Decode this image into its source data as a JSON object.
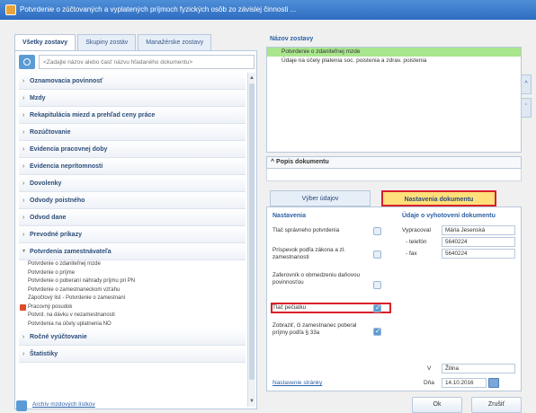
{
  "window": {
    "title": "Potvrdenie o zúčtovaných a vyplatených príjmoch fyzických osôb zo závislej činnosti ..."
  },
  "left": {
    "tabs": [
      "Všetky zostavy",
      "Skupiny zostáv",
      "Manažérske zostavy"
    ],
    "search_placeholder": "<Zadajte názov alebo časť názvu hľadaného dokumentu>",
    "categories_before": [
      "Oznamovacia povinnosť",
      "Mzdy",
      "Rekapitulácia miezd a prehľad ceny práce",
      "Rozúčtovanie",
      "Evidencia pracovnej doby",
      "Evidencia neprítomnosti",
      "Dovolenky",
      "Odvody poistného",
      "Odvod dane",
      "Prevodné príkazy"
    ],
    "open_category": "Potvrdenia zamestnávateľa",
    "subitems": [
      "Potvrdenie o zdaniteľnej mzde",
      "Potvrdenie o príjme",
      "Potvrdenie o poberaní náhrady príjmu pri PN",
      "Potvrdenie o zamestnaneckom vzťahu",
      "Zápočtový list - Potvrdenie o zamestnaní",
      "Pracovný posudok",
      "Potvrd. na dávku v nezamestnanosti",
      "Potvrdenia na účely uplatnenia NO"
    ],
    "categories_after": [
      "Ročné vyúčtovanie",
      "Štatistiky"
    ]
  },
  "right": {
    "templates_label": "Názov zostavy",
    "templates": [
      "Potvrdenie o zdaniteľnej mzde",
      "Údaje na účely platenia soc. poistenia a zdrav. poistenia"
    ],
    "desc_label": "Popis dokumentu",
    "tabs": {
      "data": "Výber údajov",
      "settings": "Nastavenia dokumentu"
    },
    "settings_title": "Nastavenia",
    "options": [
      "Tlač správneho potvrdenia",
      "Príspevok podľa zákona a zl. zamestnanosti",
      "Zaferovník o obmedzeniu daňovou povinnosťou",
      "Tlač pečiatku",
      "Zobraziť, či zamestnanec poberal príjmy podľa § 33a"
    ],
    "issuer_title": "Údaje o vyhotovení dokumentu",
    "issuer": {
      "prepared_label": "Vypracoval",
      "prepared_value": "Mária Jesenská",
      "phone_label": "- telefón",
      "phone_value": "5640224",
      "fax_label": "- fax",
      "fax_value": "5640224"
    },
    "place_label": "V",
    "place_value": "Žilina",
    "date_label": "Dňa",
    "date_value": "14.10.2016",
    "settings_link": "Nastavenie stránky"
  },
  "footer": {
    "archive_link": "Archív mzdových lístkov",
    "ok_label": "Ok",
    "cancel_label": "Zrušiť"
  },
  "colors": {
    "accent": "#2c62a8",
    "selected_row": "#a9e58d",
    "highlight_border": "#d8212a",
    "active_tab": "#ffe07a"
  }
}
